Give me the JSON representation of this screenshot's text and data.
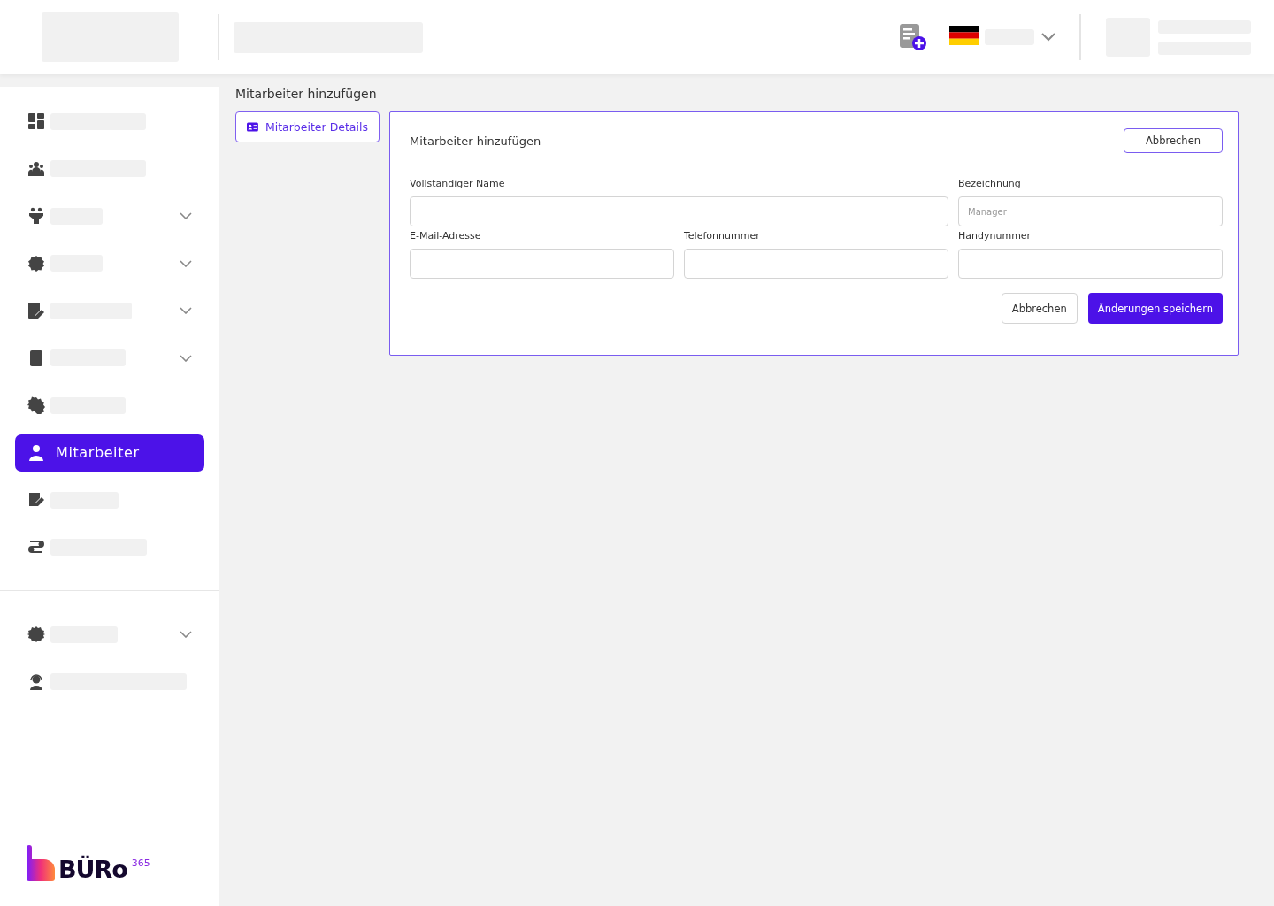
{
  "sidebar": {
    "items": [
      {
        "kind": "link",
        "selected": false
      },
      {
        "kind": "link",
        "selected": false
      },
      {
        "kind": "group",
        "selected": false
      },
      {
        "kind": "group",
        "selected": false
      },
      {
        "kind": "group",
        "selected": false
      },
      {
        "kind": "group",
        "selected": false
      },
      {
        "kind": "link",
        "selected": false
      },
      {
        "kind": "link",
        "selected": true,
        "label": "Mitarbeiter"
      },
      {
        "kind": "link",
        "selected": false
      },
      {
        "kind": "link",
        "selected": false
      }
    ],
    "bottom_items": [
      {
        "kind": "group",
        "selected": false
      },
      {
        "kind": "link",
        "selected": false
      }
    ],
    "logo": {
      "text": "BÜRo",
      "sup": "365"
    }
  },
  "page_title": "Mitarbeiter hinzufügen",
  "tabs": [
    {
      "label": "Mitarbeiter Details",
      "selected": true
    }
  ],
  "form": {
    "title": "Mitarbeiter hinzufügen",
    "header_button": "Abbrechen",
    "fields": [
      {
        "label": "Vollständiger Name"
      },
      {
        "label": "Bezeichnung",
        "placeholder": "Manager"
      },
      {
        "label": "E-Mail-Adresse"
      },
      {
        "label": "Telefonnummer"
      },
      {
        "label": "Handynummer"
      }
    ],
    "cancel_button": "Abbrechen",
    "save_button": "Änderungen speichern"
  }
}
